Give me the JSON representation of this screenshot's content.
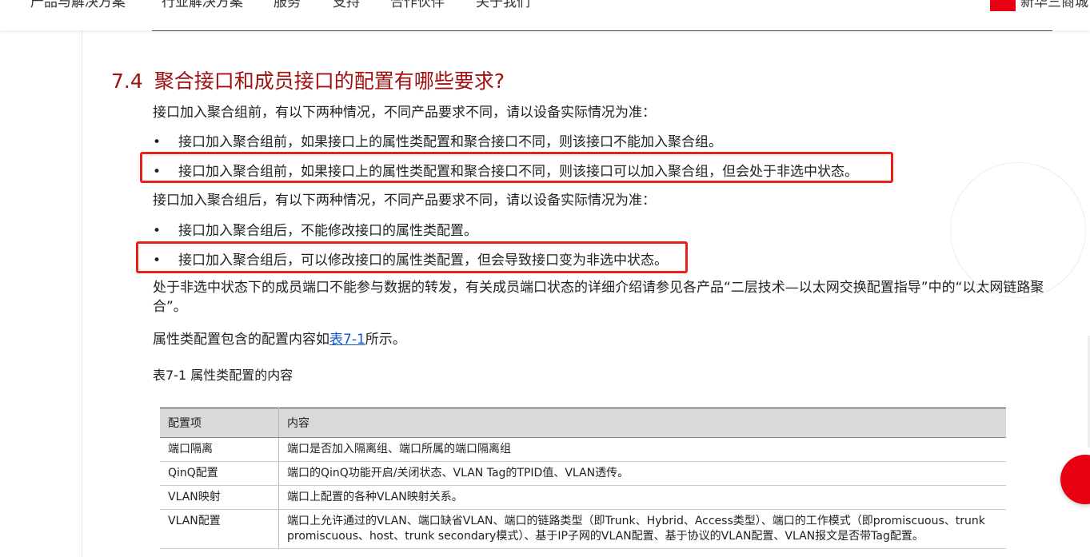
{
  "nav": {
    "items": [
      "产品与解决方案",
      "行业解决方案",
      "服务",
      "支持",
      "合作伙伴",
      "关于我们"
    ],
    "brand_text": "新华三商城"
  },
  "section": {
    "number": "7.4",
    "title": "聚合接口和成员接口的配置有哪些要求?"
  },
  "content": {
    "intro_before": "接口加入聚合组前，有以下两种情况，不同产品要求不同，请以设备实际情况为准：",
    "bullets_before": [
      "接口加入聚合组前，如果接口上的属性类配置和聚合接口不同，则该接口不能加入聚合组。",
      "接口加入聚合组前，如果接口上的属性类配置和聚合接口不同，则该接口可以加入聚合组，但会处于非选中状态。"
    ],
    "intro_after": "接口加入聚合组后，有以下两种情况，不同产品要求不同，请以设备实际情况为准：",
    "bullets_after": [
      "接口加入聚合组后，不能修改接口的属性类配置。",
      "接口加入聚合组后，可以修改接口的属性类配置，但会导致接口变为非选中状态。"
    ],
    "note": "处于非选中状态下的成员端口不能参与数据的转发，有关成员端口状态的详细介绍请参见各产品“二层技术—以太网交换配置指导”中的“以太网链路聚合”。",
    "ref_prefix": "属性类配置包含的配置内容如",
    "ref_link": "表7-1",
    "ref_suffix": "所示。",
    "bullet_char": "•"
  },
  "table": {
    "caption": "表7-1 属性类配置的内容",
    "headers": [
      "配置项",
      "内容"
    ],
    "rows": [
      [
        "端口隔离",
        "端口是否加入隔离组、端口所属的端口隔离组"
      ],
      [
        "QinQ配置",
        "端口的QinQ功能开启/关闭状态、VLAN Tag的TPID值、VLAN透传。"
      ],
      [
        "VLAN映射",
        "端口上配置的各种VLAN映射关系。"
      ],
      [
        "VLAN配置",
        "端口上允许通过的VLAN、端口缺省VLAN、端口的链路类型（即Trunk、Hybrid、Access类型）、端口的工作模式（即promiscuous、trunk promiscuous、host、trunk secondary模式）、基于IP子网的VLAN配置、基于协议的VLAN配置、VLAN报文是否带Tag配置。"
      ]
    ]
  },
  "colors": {
    "title": "#a01010",
    "highlight": "#e8211b",
    "link": "#1155cc",
    "brand": "#e60012"
  }
}
